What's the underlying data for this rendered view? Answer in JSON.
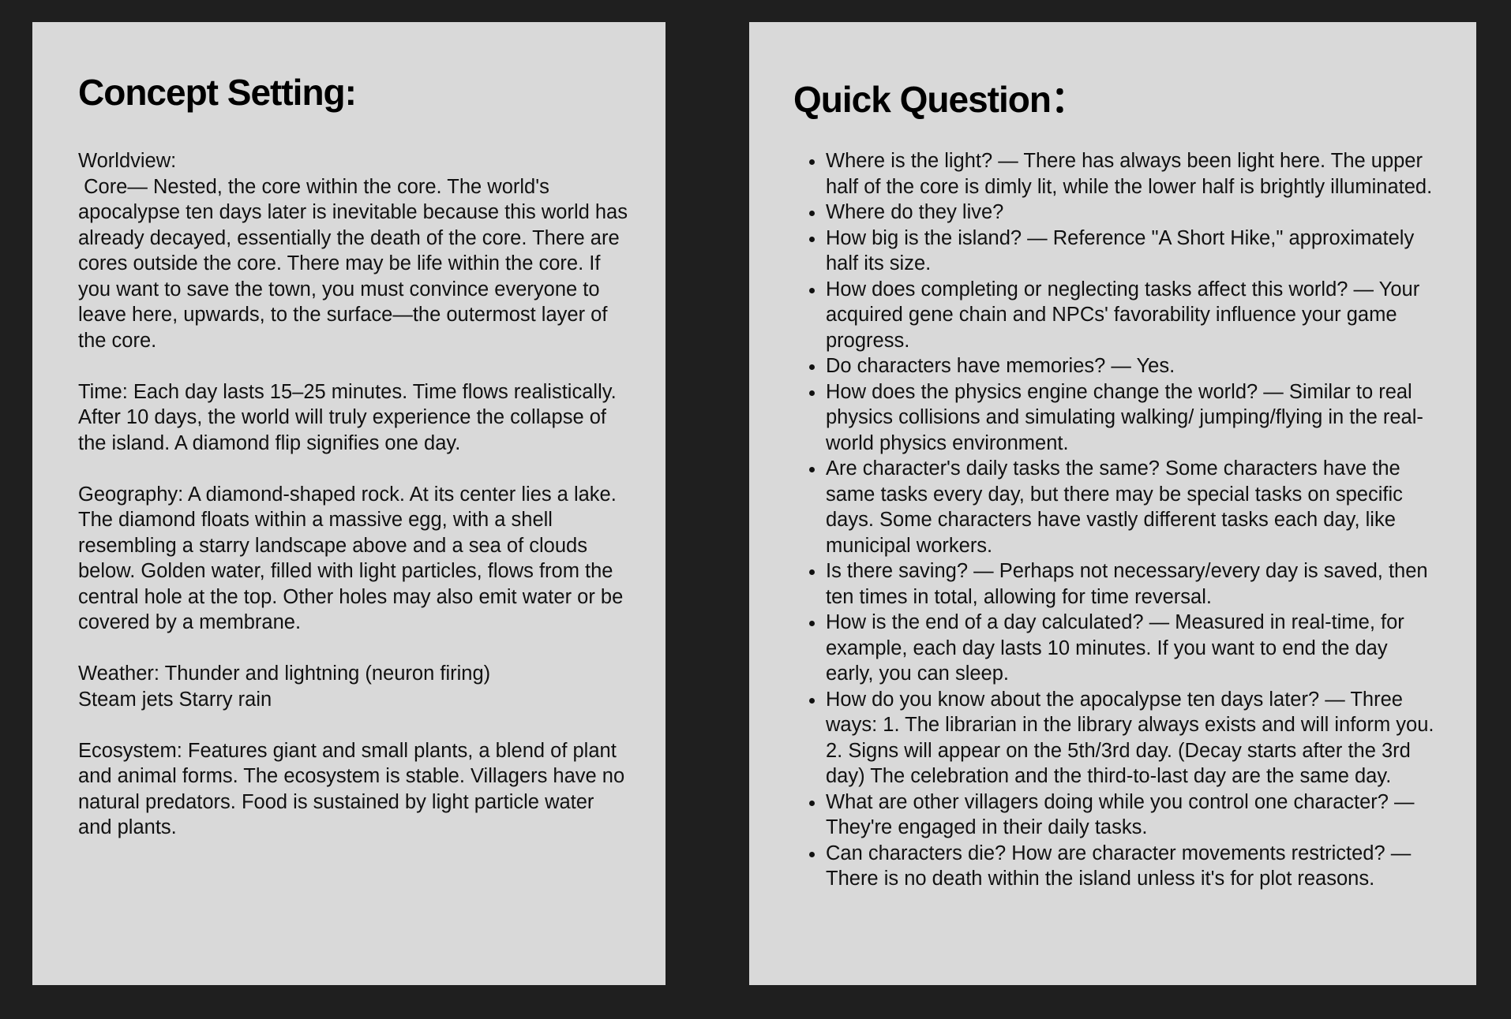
{
  "concept": {
    "title": "Concept Setting:",
    "paragraphs": [
      "Worldview:\n Core— Nested, the core within the core. The world's apocalypse ten days later is inevitable because this world has already decayed, essentially the death of the core. There are cores outside the core. There may be life within the core. If you want to save the town, you must convince everyone to leave here, upwards, to the surface—the outermost layer of the core.",
      "Time: Each day lasts 15–25 minutes. Time flows realistically. After 10 days, the world will truly experience the collapse of the island. A diamond flip signifies one day.",
      "Geography: A diamond-shaped rock. At its center lies a lake. The diamond floats within a massive egg, with a shell resembling a starry landscape above and a sea of clouds below. Golden water, filled with light particles, flows from the central hole at the top. Other holes may also emit water or be covered by a membrane.",
      "Weather: Thunder and lightning (neuron firing)\nSteam jets Starry rain",
      "Ecosystem: Features giant and small plants, a blend of plant and animal forms. The ecosystem is stable. Villagers have no natural predators. Food is sustained by light particle water and plants."
    ]
  },
  "questions": {
    "title": "Quick Question：",
    "items": [
      "Where is the light? — There has always been light here. The upper half of the core is dimly lit, while the lower half is brightly illuminated.",
      "Where do they live?",
      "How big is the island? — Reference \"A Short Hike,\" approximately half its size.",
      "How does completing or neglecting tasks affect this world? — Your acquired gene chain and NPCs' favorability influence your game progress.",
      "Do characters have memories? — Yes.",
      "How does the physics engine change the world? — Similar to real physics collisions and simulating walking/ jumping/flying in the real-world physics environment.",
      "Are character's daily tasks the same? Some characters have the same tasks every day, but there may be special tasks on specific days. Some characters have vastly different tasks each day, like municipal workers.",
      "Is there saving? — Perhaps not necessary/every day is saved, then ten times in total, allowing for time reversal.",
      "How is the end of a day calculated? — Measured in real-time, for example, each day lasts 10 minutes. If you want to end the day early, you can sleep.",
      "How do you know about the apocalypse ten days later? — Three ways: 1. The librarian in the library always exists and will inform you. 2. Signs will appear on the 5th/3rd day. (Decay starts after the 3rd day) The celebration and the third-to-last day are the same day.",
      "What are other villagers doing while you control one character? — They're engaged in their daily tasks.",
      "Can characters die? How are character movements restricted? — There is no death within the island unless it's for plot reasons."
    ]
  }
}
